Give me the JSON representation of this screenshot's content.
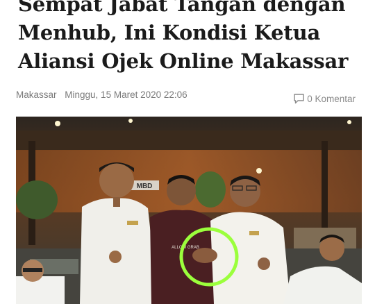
{
  "article": {
    "title_lines": [
      "Sempat Jabat Tangan dengan",
      "Menhub, Ini Kondisi Ketua",
      "Aliansi Ojek Online Makassar"
    ],
    "category": "Makassar",
    "date": "Minggu, 15 Maret 2020 22:06",
    "comments_label": "0 Komentar"
  },
  "photo": {
    "shirt_print": "ALLOW GRAB",
    "background_sign": "MBD",
    "highlight_color": "#9bff3c"
  },
  "icons": {
    "comments": "comment-bubble-icon"
  }
}
